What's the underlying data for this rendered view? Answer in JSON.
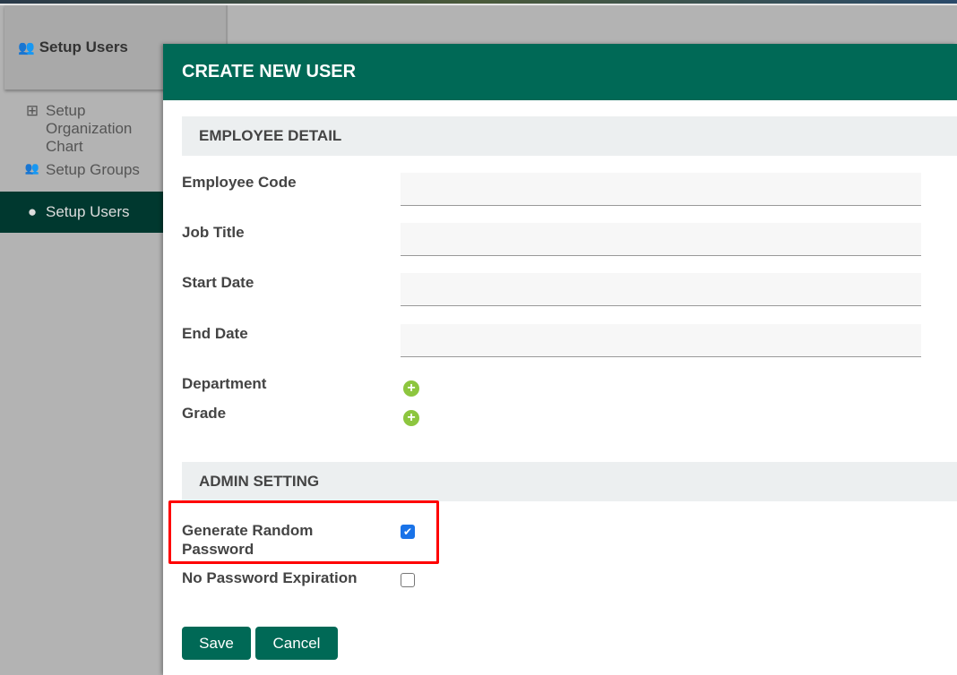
{
  "sidebar": {
    "header": "Setup Users",
    "items": [
      {
        "label": "Setup Organization Chart",
        "icon": "sitemap-icon"
      },
      {
        "label": "Setup Groups",
        "icon": "users-icon"
      },
      {
        "label": "Setup Users",
        "icon": "user-icon",
        "active": true
      }
    ]
  },
  "modal": {
    "title": "CREATE NEW USER",
    "employee_section": "EMPLOYEE DETAIL",
    "fields": {
      "employee_code": "Employee Code",
      "job_title": "Job Title",
      "start_date": "Start Date",
      "end_date": "End Date",
      "department": "Department",
      "grade": "Grade"
    },
    "admin_section": "ADMIN SETTING",
    "generate_random_password": {
      "label": "Generate Random Password",
      "checked": true
    },
    "no_password_expiration": {
      "label": "No Password Expiration",
      "checked": false
    },
    "save": "Save",
    "cancel": "Cancel"
  },
  "colors": {
    "primary": "#006956",
    "highlight": "#ff0000",
    "add": "#8dc63f"
  }
}
